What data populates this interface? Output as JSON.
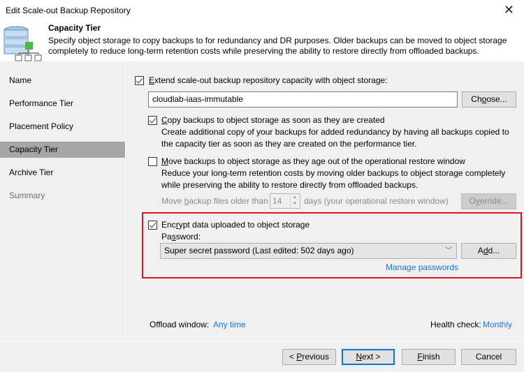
{
  "window": {
    "title": "Edit Scale-out Backup Repository",
    "close_icon": "close-icon"
  },
  "header": {
    "icon": "database-hierarchy-icon",
    "title": "Capacity Tier",
    "description": "Specify object storage to copy backups to for redundancy and DR purposes. Older backups can be moved to object storage completely to reduce long-term retention costs while preserving the ability to restore directly from offloaded backups."
  },
  "sidebar": {
    "items": [
      {
        "label": "Name",
        "state": "normal"
      },
      {
        "label": "Performance Tier",
        "state": "normal"
      },
      {
        "label": "Placement Policy",
        "state": "normal"
      },
      {
        "label": "Capacity Tier",
        "state": "active"
      },
      {
        "label": "Archive Tier",
        "state": "normal"
      },
      {
        "label": "Summary",
        "state": "disabled"
      }
    ]
  },
  "main": {
    "extend": {
      "checked": true,
      "label_pre": "",
      "label_u": "E",
      "label_post": "xtend scale-out backup repository capacity with object storage:"
    },
    "repository_value": "cloudlab-iaas-immutable",
    "choose_button": {
      "pre": "Ch",
      "u": "o",
      "post": "ose..."
    },
    "copy": {
      "checked": true,
      "label_u": "C",
      "label_post": "opy backups to object storage as soon as they are created",
      "description": "Create additional copy of your backups for added redundancy by having all backups copied to the capacity tier as soon as they are created on the performance tier."
    },
    "move": {
      "checked": false,
      "label_u": "M",
      "label_post": "ove backups to object storage as they age out of the operational restore window",
      "description": "Reduce your long-term retention costs by moving older backups to object storage completely while preserving the ability to restore directly from offloaded backups.",
      "older_pre": "Move ",
      "older_u": "b",
      "older_post": "ackup files older than",
      "days_value": "14",
      "days_suffix": "days (your operational restore window)",
      "override_button": {
        "pre": "O",
        "u": "v",
        "post": "erride..."
      }
    },
    "encrypt": {
      "checked": true,
      "label_pre": "Enc",
      "label_u": "r",
      "label_post": "ypt data uploaded to object storage",
      "password_label_pre": "Pa",
      "password_label_u": "s",
      "password_label_post": "sword:",
      "password_selected": "Super secret password (Last edited: 502 days ago)",
      "add_button": {
        "pre": "A",
        "u": "d",
        "post": "d..."
      },
      "manage_link": "Manage passwords"
    },
    "offload_label": "Offload window:",
    "offload_value": "Any time",
    "health_label": "Health check:",
    "health_value": "Monthly"
  },
  "footer": {
    "previous": {
      "pre": "< ",
      "u": "P",
      "post": "revious"
    },
    "next": {
      "pre": "",
      "u": "N",
      "post": "ext >"
    },
    "finish": {
      "pre": "",
      "u": "F",
      "post": "inish"
    },
    "cancel": "Cancel"
  },
  "colors": {
    "accent": "#0078d7",
    "link": "#1a73e8",
    "highlight_box": "#e0141e",
    "active_nav": "#a6a6a6"
  }
}
